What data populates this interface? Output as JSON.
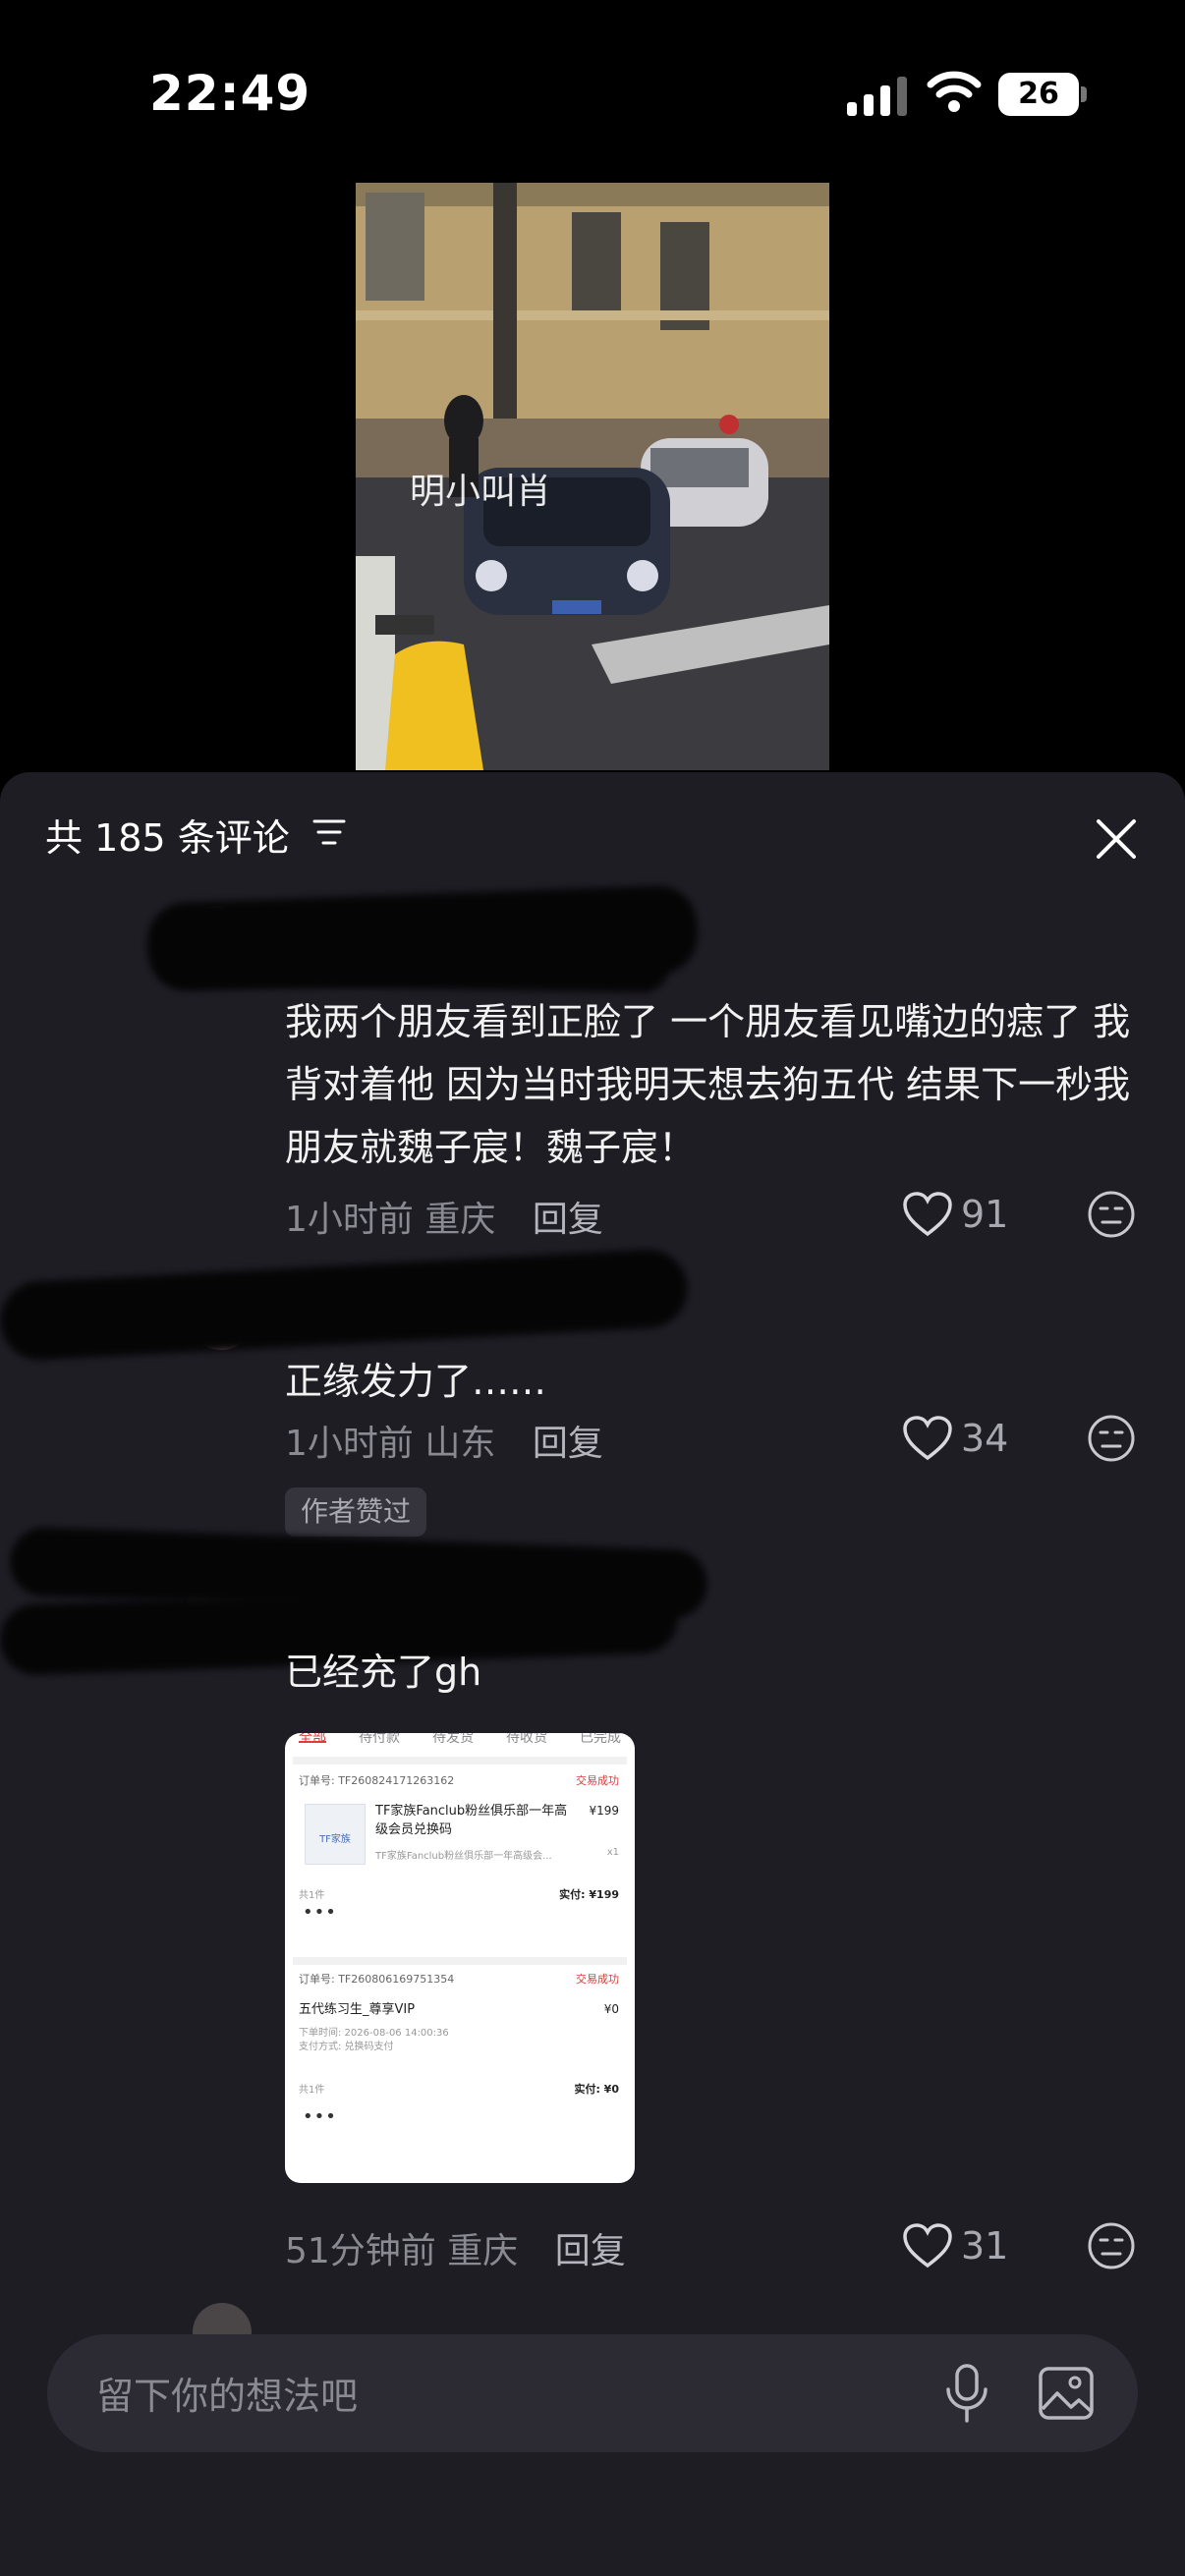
{
  "status_bar": {
    "time": "22:49",
    "battery": "26"
  },
  "video": {
    "watermark": "明小叫肖"
  },
  "header": {
    "count_label": "共 185 条评论"
  },
  "comments": [
    {
      "text": "我两个朋友看到正脸了 一个朋友看见嘴边的痣了 我背对着他 因为当时我明天想去狗五代 结果下一秒我朋友就魏子宸！魏子宸！",
      "time": "1小时前",
      "location": "重庆",
      "reply": "回复",
      "likes": "91"
    },
    {
      "text": "正缘发力了……",
      "time": "1小时前",
      "location": "山东",
      "reply": "回复",
      "likes": "34"
    },
    {
      "badge": "作者赞过",
      "text": "已经充了gh",
      "time": "51分钟前",
      "location": "重庆",
      "reply": "回复",
      "likes": "31"
    }
  ],
  "order_image": {
    "tabs": [
      "全部",
      "待付款",
      "待发货",
      "待收货",
      "已完成"
    ],
    "orders": [
      {
        "order_no": "订单号: TF260824171263162",
        "status": "交易成功",
        "title": "TF家族Fanclub粉丝俱乐部一年高级会员兑换码",
        "subtitle": "TF家族Fanclub粉丝俱乐部一年高级会...",
        "price": "¥199",
        "qty": "x1",
        "count": "共1件",
        "paid": "实付: ¥199",
        "thumb_label": "TF家族"
      },
      {
        "order_no": "订单号: TF260806169751354",
        "status": "交易成功",
        "title": "五代练习生_尊享VIP",
        "price": "¥0",
        "order_time": "下单时间: 2026-08-06 14:00:36",
        "pay_method": "支付方式: 兑换码支付",
        "count": "共1件",
        "paid": "实付: ¥0"
      }
    ]
  },
  "input": {
    "placeholder": "留下你的想法吧"
  }
}
